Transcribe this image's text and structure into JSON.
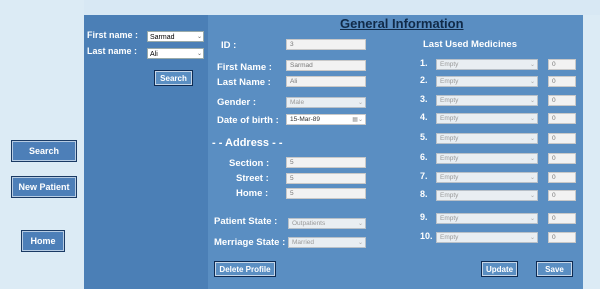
{
  "nav": {
    "search_label": "Search",
    "new_patient_label": "New Patient",
    "home_label": "Home"
  },
  "search": {
    "first_name_label": "First name :",
    "first_name_value": "Sarmad",
    "last_name_label": "Last name :",
    "last_name_value": "Ali",
    "search_button": "Search"
  },
  "main": {
    "title": "General Information",
    "id_label": "ID :",
    "id_value": "3",
    "first_name_label": "First Name :",
    "first_name_value": "Sarmad",
    "last_name_label": "Last Name :",
    "last_name_value": "Ali",
    "gender_label": "Gender  :",
    "gender_value": "Male",
    "dob_label": "Date of birth :",
    "dob_value": "15-Mar-89",
    "address_heading": "- - Address - -",
    "section_label": "Section  :",
    "section_value": "5",
    "street_label": "Street  :",
    "street_value": "5",
    "home_label": "Home  :",
    "home_value": "5",
    "patient_state_label": "Patient State  :",
    "patient_state_value": "Outpatients",
    "merriage_state_label": "Merriage State :",
    "merriage_state_value": "Married",
    "delete_button": "Delete Profile",
    "update_button": "Update",
    "save_button": "Save"
  },
  "medicines": {
    "heading": "Last Used Medicines",
    "items": [
      {
        "no": "1.",
        "name": "Empty",
        "qty": "0"
      },
      {
        "no": "2.",
        "name": "Empty",
        "qty": "0"
      },
      {
        "no": "3.",
        "name": "Empty",
        "qty": "0"
      },
      {
        "no": "4.",
        "name": "Empty",
        "qty": "0"
      },
      {
        "no": "5.",
        "name": "Empty",
        "qty": "0"
      },
      {
        "no": "6.",
        "name": "Empty",
        "qty": "0"
      },
      {
        "no": "7.",
        "name": "Empty",
        "qty": "0"
      },
      {
        "no": "8.",
        "name": "Empty",
        "qty": "0"
      },
      {
        "no": "9.",
        "name": "Empty",
        "qty": "0"
      },
      {
        "no": "10.",
        "name": "Empty",
        "qty": "0"
      }
    ]
  },
  "icons": {
    "dropdown": "chevron-down-icon",
    "calendar": "calendar-icon"
  }
}
